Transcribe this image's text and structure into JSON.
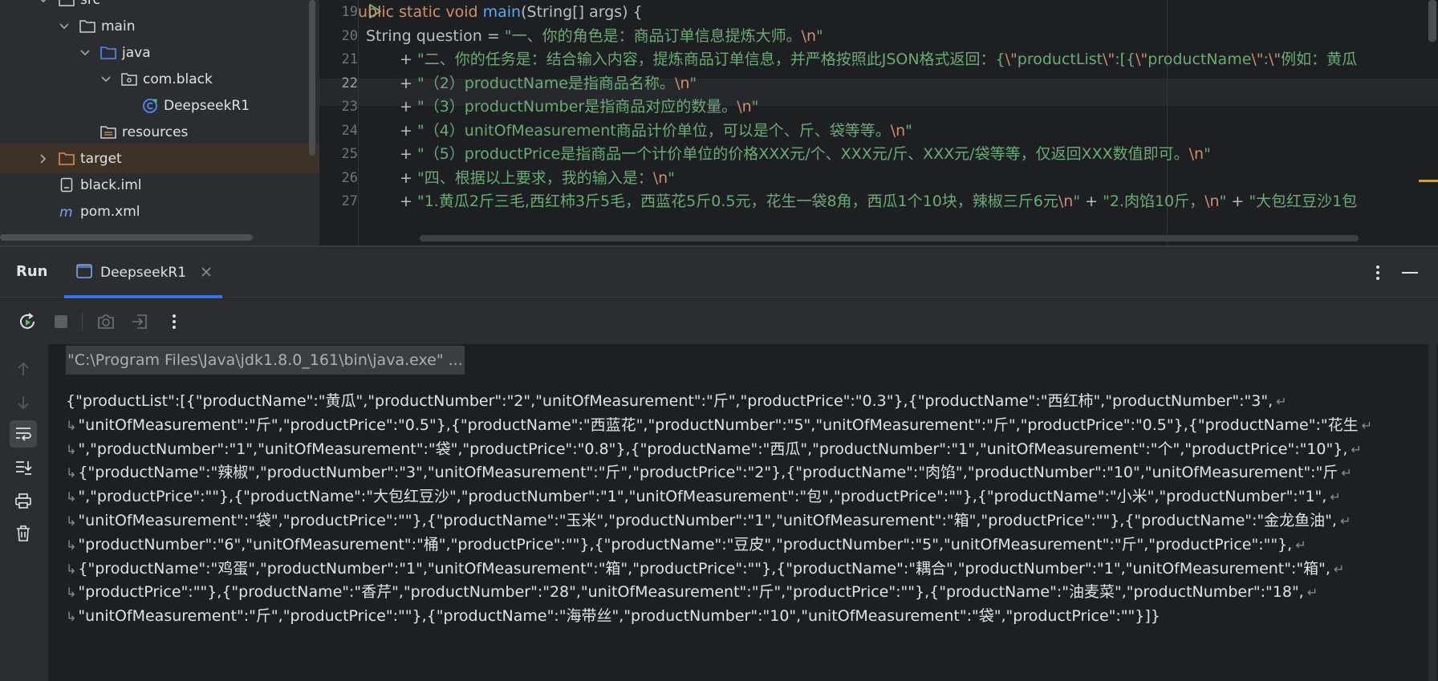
{
  "project_tree": [
    {
      "label": "src",
      "kind": "folder",
      "expanded": true,
      "indent": 1
    },
    {
      "label": "main",
      "kind": "folder",
      "expanded": true,
      "indent": 2
    },
    {
      "label": "java",
      "kind": "source-folder",
      "expanded": true,
      "indent": 3
    },
    {
      "label": "com.black",
      "kind": "package",
      "expanded": true,
      "indent": 4
    },
    {
      "label": "DeepseekR1",
      "kind": "java-class",
      "indent": 5
    },
    {
      "label": "resources",
      "kind": "resource-folder",
      "indent": 3
    },
    {
      "label": "target",
      "kind": "excluded-folder",
      "expanded": false,
      "indent": 1,
      "selected": true
    },
    {
      "label": "black.iml",
      "kind": "iml-file",
      "indent": 1
    },
    {
      "label": "pom.xml",
      "kind": "maven-file",
      "indent": 1
    }
  ],
  "editor": {
    "current_line": "22",
    "lines": [
      {
        "num": "19",
        "segments": [
          [
            "k",
            "ublic static void "
          ],
          [
            "fn",
            "main"
          ],
          [
            "pl",
            "(String[] args) {"
          ]
        ]
      },
      {
        "num": "20",
        "segments": [
          [
            "pl",
            "String question = "
          ],
          [
            "str",
            "\"一、你的角色是：商品订单信息提炼大师。"
          ],
          [
            "esc",
            "\\n"
          ],
          [
            "str",
            "\""
          ]
        ]
      },
      {
        "num": "21",
        "segments": [
          [
            "pl",
            "+ "
          ],
          [
            "str",
            "\"二、你的任务是：结合输入内容，提炼商品订单信息，并严格按照此JSON格式返回：{"
          ],
          [
            "esc",
            "\\\""
          ],
          [
            "str",
            "productList"
          ],
          [
            "esc",
            "\\\""
          ],
          [
            "str",
            ":[{"
          ],
          [
            "esc",
            "\\\""
          ],
          [
            "str",
            "productName"
          ],
          [
            "esc",
            "\\\""
          ],
          [
            "str",
            ":"
          ],
          [
            "esc",
            "\\\""
          ],
          [
            "str",
            "例如：黄瓜"
          ]
        ]
      },
      {
        "num": "22",
        "segments": [
          [
            "pl",
            "+ "
          ],
          [
            "str",
            "\"（2）productName是指商品名称。"
          ],
          [
            "esc",
            "\\n"
          ],
          [
            "str",
            "\""
          ]
        ]
      },
      {
        "num": "23",
        "segments": [
          [
            "pl",
            "+ "
          ],
          [
            "str",
            "\"（3）productNumber是指商品对应的数量。"
          ],
          [
            "esc",
            "\\n"
          ],
          [
            "str",
            "\""
          ]
        ]
      },
      {
        "num": "24",
        "segments": [
          [
            "pl",
            "+ "
          ],
          [
            "str",
            "\"（4）unitOfMeasurement商品计价单位，可以是个、斤、袋等等。"
          ],
          [
            "esc",
            "\\n"
          ],
          [
            "str",
            "\""
          ]
        ]
      },
      {
        "num": "25",
        "segments": [
          [
            "pl",
            "+ "
          ],
          [
            "str",
            "\"（5）productPrice是指商品一个计价单位的价格XXX元/个、XXX元/斤、XXX元/袋等等，仅返回XXX数值即可。"
          ],
          [
            "esc",
            "\\n"
          ],
          [
            "str",
            "\""
          ]
        ]
      },
      {
        "num": "26",
        "segments": [
          [
            "pl",
            "+ "
          ],
          [
            "str",
            "\"四、根据以上要求，我的输入是："
          ],
          [
            "esc",
            "\\n"
          ],
          [
            "str",
            "\""
          ]
        ]
      },
      {
        "num": "27",
        "segments": [
          [
            "pl",
            "+ "
          ],
          [
            "str",
            "\"1.黄瓜2斤三毛,西红柿3斤5毛，西蓝花5斤0.5元，花生一袋8角，西瓜1个10块，辣椒三斤6元"
          ],
          [
            "esc",
            "\\n"
          ],
          [
            "str",
            "\""
          ],
          [
            "pl",
            " + "
          ],
          [
            "str",
            "\"2.肉馅10斤，"
          ],
          [
            "esc",
            "\\n"
          ],
          [
            "str",
            "\""
          ],
          [
            "pl",
            " + "
          ],
          [
            "str",
            "\"大包红豆沙1包"
          ]
        ]
      }
    ]
  },
  "run_panel": {
    "title": "Run",
    "tab_label": "DeepseekR1",
    "command_line": "\"C:\\Program Files\\Java\\jdk1.8.0_161\\bin\\java.exe\" ...",
    "output_lines": [
      "{\"productList\":[{\"productName\":\"黄瓜\",\"productNumber\":\"2\",\"unitOfMeasurement\":\"斤\",\"productPrice\":\"0.3\"},{\"productName\":\"西红柿\",\"productNumber\":\"3\",",
      "\"unitOfMeasurement\":\"斤\",\"productPrice\":\"0.5\"},{\"productName\":\"西蓝花\",\"productNumber\":\"5\",\"unitOfMeasurement\":\"斤\",\"productPrice\":\"0.5\"},{\"productName\":\"花生",
      "\",\"productNumber\":\"1\",\"unitOfMeasurement\":\"袋\",\"productPrice\":\"0.8\"},{\"productName\":\"西瓜\",\"productNumber\":\"1\",\"unitOfMeasurement\":\"个\",\"productPrice\":\"10\"},",
      "{\"productName\":\"辣椒\",\"productNumber\":\"3\",\"unitOfMeasurement\":\"斤\",\"productPrice\":\"2\"},{\"productName\":\"肉馅\",\"productNumber\":\"10\",\"unitOfMeasurement\":\"斤",
      "\",\"productPrice\":\"\"},{\"productName\":\"大包红豆沙\",\"productNumber\":\"1\",\"unitOfMeasurement\":\"包\",\"productPrice\":\"\"},{\"productName\":\"小米\",\"productNumber\":\"1\",",
      "\"unitOfMeasurement\":\"袋\",\"productPrice\":\"\"},{\"productName\":\"玉米\",\"productNumber\":\"1\",\"unitOfMeasurement\":\"箱\",\"productPrice\":\"\"},{\"productName\":\"金龙鱼油\",",
      "\"productNumber\":\"6\",\"unitOfMeasurement\":\"桶\",\"productPrice\":\"\"},{\"productName\":\"豆皮\",\"productNumber\":\"5\",\"unitOfMeasurement\":\"斤\",\"productPrice\":\"\"},",
      "{\"productName\":\"鸡蛋\",\"productNumber\":\"1\",\"unitOfMeasurement\":\"箱\",\"productPrice\":\"\"},{\"productName\":\"耦合\",\"productNumber\":\"1\",\"unitOfMeasurement\":\"箱\",",
      "\"productPrice\":\"\"},{\"productName\":\"香芹\",\"productNumber\":\"28\",\"unitOfMeasurement\":\"斤\",\"productPrice\":\"\"},{\"productName\":\"油麦菜\",\"productNumber\":\"18\",",
      "\"unitOfMeasurement\":\"斤\",\"productPrice\":\"\"},{\"productName\":\"海带丝\",\"productNumber\":\"10\",\"unitOfMeasurement\":\"袋\",\"productPrice\":\"\"}]}"
    ]
  },
  "colors": {
    "accent": "#3574f0",
    "keyword": "#cf8e6d",
    "string": "#6aab73",
    "function": "#56a8f5",
    "run_green": "#5fb865"
  }
}
